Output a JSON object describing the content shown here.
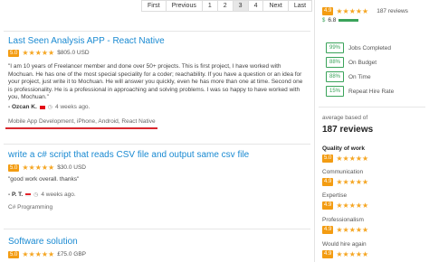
{
  "pager": {
    "items": [
      "First",
      "Previous",
      "1",
      "2",
      "3",
      "4",
      "Next",
      "Last"
    ],
    "active": "3"
  },
  "reviews": [
    {
      "title": "Last Seen Analysis APP - React Native",
      "rating": "5.0",
      "amount": "$805.0 USD",
      "text": "\"I am 10 years of Freelancer member and done over 50+ projects. This is first project, I have worked with Mochuan. He has one of the most special speciality for a coder; reachability. If you have a question or an idea for your project, just write it to Mochuan. He will answer you quickly, even he has more than one at time. Second one is professionality. He is a professional in approaching and solving problems. I was so happy to have worked with you, Mochuan.\"",
      "author": "- Ozcan K.",
      "time": "4 weeks ago.",
      "tags": "Mobile App Development, iPhone, Android, React Native"
    },
    {
      "title": "write a c# script that reads CSV file and output same csv file",
      "rating": "5.0",
      "amount": "$30.0 USD",
      "text": "\"good work overall. thanks\"",
      "author": "- P. T.",
      "time": "4 weeks ago.",
      "tags": "C# Programming"
    },
    {
      "title": "Software solution",
      "rating": "5.0",
      "amount": "£75.0 GBP"
    }
  ],
  "sidebar": {
    "rating": "4.9",
    "reviews_count": "187 reviews",
    "earnings": "6.8",
    "metrics": [
      {
        "pct": "99%",
        "label": "Jobs Completed"
      },
      {
        "pct": "88%",
        "label": "On Budget"
      },
      {
        "pct": "88%",
        "label": "On Time"
      },
      {
        "pct": "15%",
        "label": "Repeat Hire Rate"
      }
    ],
    "avg_label": "average based of",
    "avg_count": "187 reviews",
    "categories": [
      {
        "label": "Quality of work",
        "score": "5.0"
      },
      {
        "label": "Communication",
        "score": "4.9"
      },
      {
        "label": "Expertise",
        "score": "4.9"
      },
      {
        "label": "Professionalism",
        "score": "4.9"
      },
      {
        "label": "Would hire again",
        "score": "4.9"
      }
    ]
  },
  "colors": {
    "accent": "#1a8ad2",
    "star": "#f5a623",
    "badge": "#f39c12",
    "green": "#3aa35a",
    "underline": "#d9272e"
  }
}
